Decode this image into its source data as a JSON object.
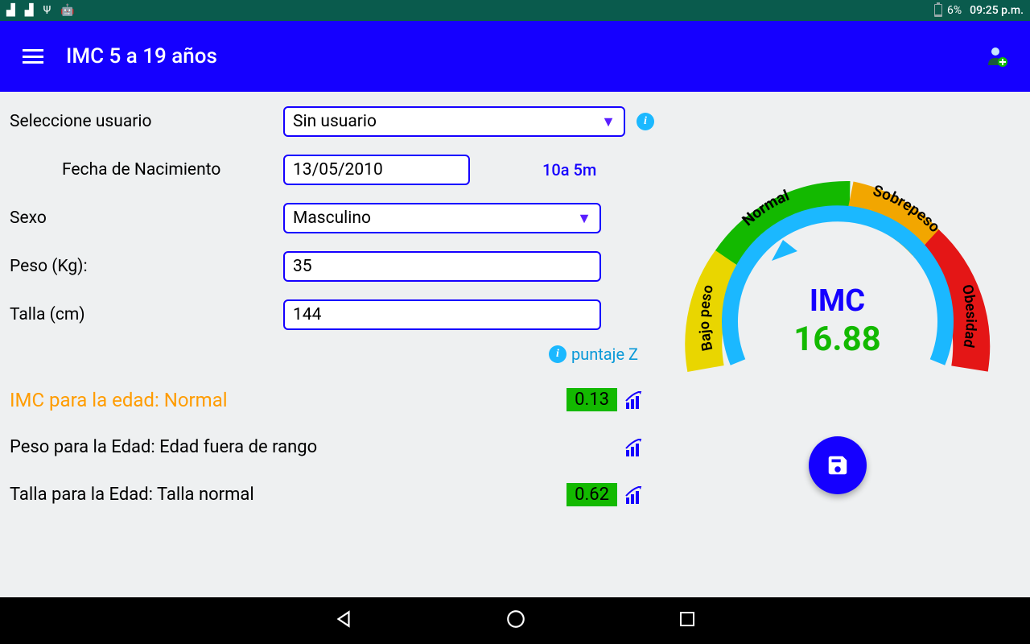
{
  "status": {
    "battery_pct": "6%",
    "time": "09:25 p.m."
  },
  "appbar": {
    "title": "IMC 5 a 19 años"
  },
  "form": {
    "select_user_label": "Seleccione usuario",
    "select_user_value": "Sin usuario",
    "dob_label": "Fecha de Nacimiento",
    "dob_value": "13/05/2010",
    "age_readout": "10a 5m",
    "sex_label": "Sexo",
    "sex_value": "Masculino",
    "weight_label": "Peso (Kg):",
    "weight_value": "35",
    "height_label": "Talla (cm)",
    "height_value": "144",
    "zscore_label": "puntaje Z"
  },
  "results": {
    "imc_label": "IMC para la edad: Normal",
    "imc_score": "0.13",
    "weight_age_label": "Peso para la Edad: Edad fuera de rango",
    "height_age_label": "Talla para la Edad:  Talla normal",
    "height_age_score": "0.62"
  },
  "gauge": {
    "title": "IMC",
    "value": "16.88",
    "segments": {
      "bajo_peso": "Bajo peso",
      "normal": "Normal",
      "sobrepeso": "Sobrepeso",
      "obesidad": "Obesidad"
    }
  },
  "chart_data": {
    "type": "gauge",
    "title": "IMC",
    "value": 16.88,
    "pointer_segment": "Normal",
    "segments": [
      {
        "name": "Bajo peso",
        "color": "#e9d600",
        "angle_start": 180,
        "angle_end": 232
      },
      {
        "name": "Normal",
        "color": "#13b900",
        "angle_start": 232,
        "angle_end": 282
      },
      {
        "name": "Sobrepeso",
        "color": "#f2a600",
        "angle_start": 282,
        "angle_end": 308
      },
      {
        "name": "Obesidad",
        "color": "#e41616",
        "angle_start": 308,
        "angle_end": 360
      }
    ]
  }
}
